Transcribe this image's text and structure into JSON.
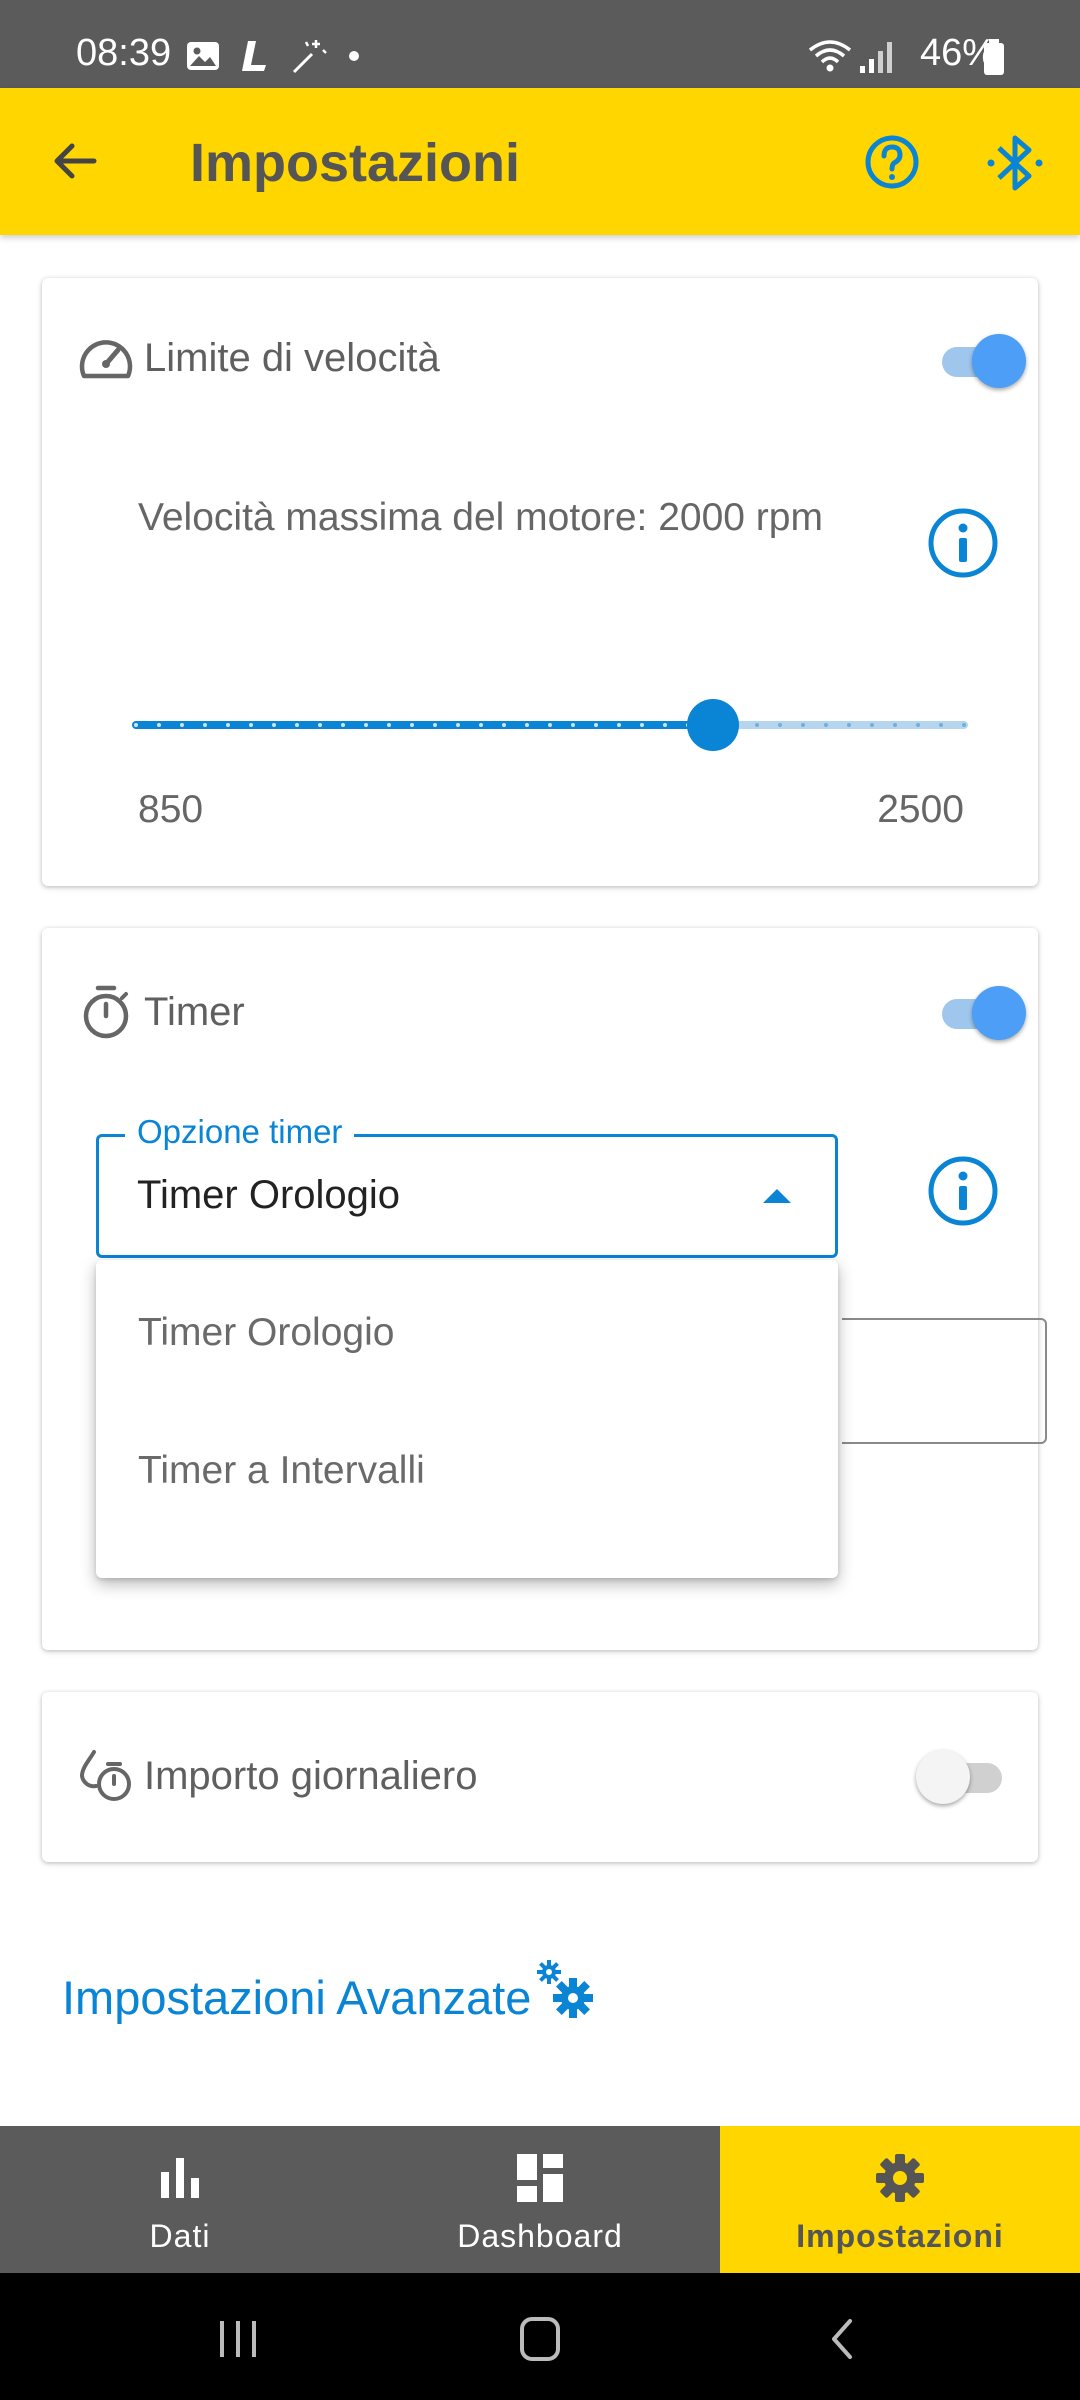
{
  "status_bar": {
    "time": "08:39",
    "battery": "46%",
    "icons": [
      "gallery-icon",
      "l-app-icon",
      "magic-wand-icon",
      "dot-icon",
      "wifi-icon",
      "signal-icon",
      "battery-icon"
    ]
  },
  "app_bar": {
    "title": "Impostazioni",
    "back_icon": "arrow-back-icon",
    "help_icon": "help-circle-icon",
    "bluetooth_icon": "bluetooth-icon",
    "background": "#ffd600"
  },
  "speed_card": {
    "title": "Limite di velocità",
    "enabled": true,
    "description": "Velocità massima del motore: 2000 rpm",
    "slider": {
      "min": 850,
      "max": 2500,
      "value": 2000
    },
    "min_label": "850",
    "max_label": "2500"
  },
  "timer_card": {
    "title": "Timer",
    "enabled": true,
    "dropdown": {
      "label": "Opzione timer",
      "value": "Timer Orologio",
      "options": [
        "Timer Orologio",
        "Timer a Intervalli"
      ]
    }
  },
  "daily_card": {
    "title": "Importo giornaliero",
    "enabled": false
  },
  "advanced_link": "Impostazioni Avanzate",
  "bottom_nav": {
    "items": [
      {
        "label": "Dati",
        "icon": "bar-chart-icon",
        "active": false
      },
      {
        "label": "Dashboard",
        "icon": "dashboard-icon",
        "active": false
      },
      {
        "label": "Impostazioni",
        "icon": "gear-icon",
        "active": true
      }
    ]
  },
  "colors": {
    "accent": "#0a84d4",
    "toggle_on": "#4c9ef6",
    "nav_bg": "#5b5b5b"
  }
}
